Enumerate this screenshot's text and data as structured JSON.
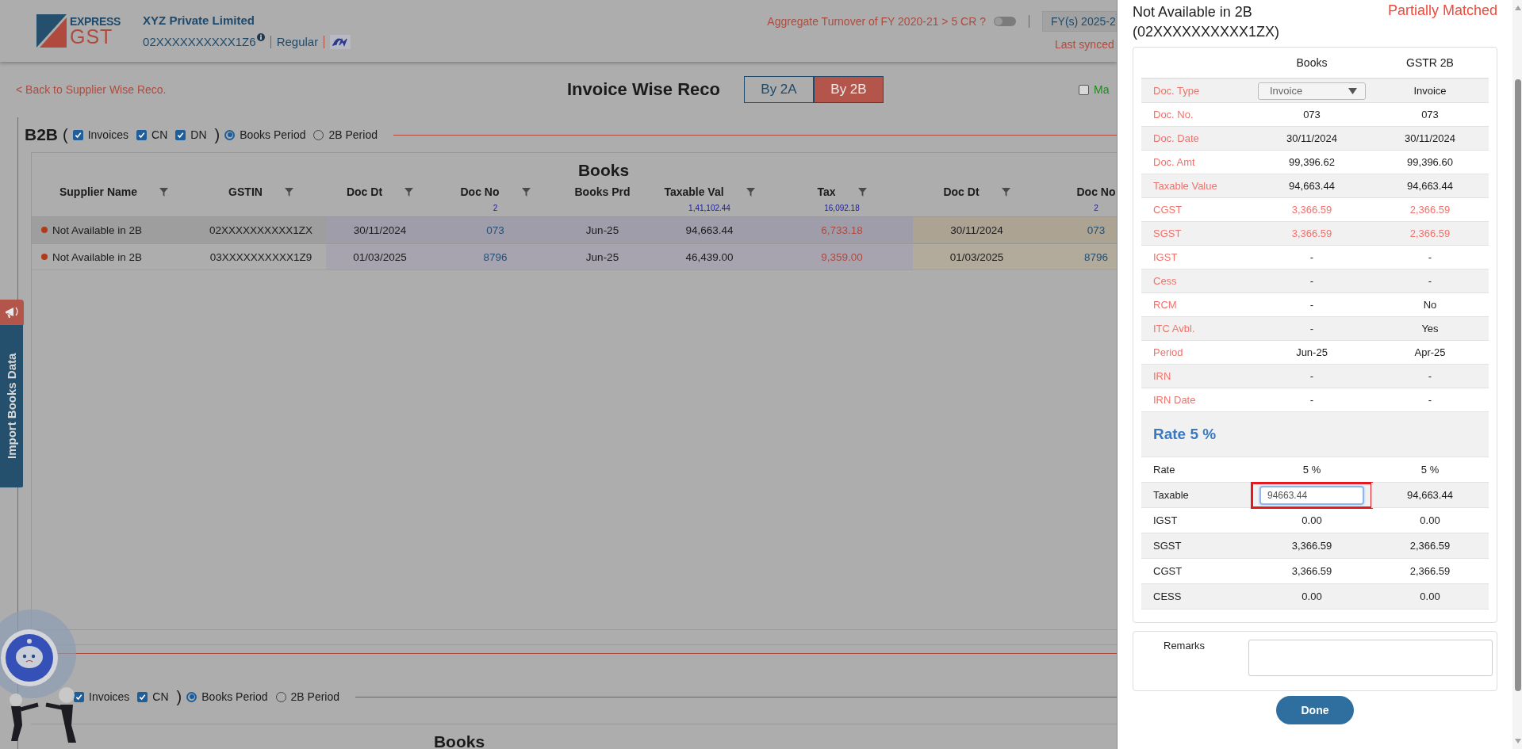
{
  "header": {
    "logo": {
      "line1": "EXPRESS",
      "line2": "GST"
    },
    "company": "XYZ Private Limited",
    "gstin": "02XXXXXXXXXX1Z6",
    "registration": "Regular",
    "turnover_label": "Aggregate Turnover of FY 2020-21 > 5 CR ?",
    "turnover_toggle": {
      "on": false
    },
    "fy": "FY(s) 2025-2",
    "last_synced": "Last synced"
  },
  "nav": {
    "back_link": "< Back to Supplier Wise Reco.",
    "title": "Invoice Wise Reco",
    "tabs": [
      {
        "label": "By 2A",
        "selected": false
      },
      {
        "label": "By 2B",
        "selected": true
      }
    ],
    "match_filter": {
      "label": "Ma",
      "checked": false
    }
  },
  "side_tab": {
    "label": "Import Books Data"
  },
  "sections": [
    {
      "title": "B2B",
      "open_paren": "(",
      "close_paren": ")",
      "filters": [
        {
          "label": "Invoices",
          "checked": true
        },
        {
          "label": "CN",
          "checked": true
        },
        {
          "label": "DN",
          "checked": true
        }
      ],
      "periods": [
        {
          "label": "Books Period",
          "selected": true
        },
        {
          "label": "2B Period",
          "selected": false
        }
      ],
      "table": {
        "group_heading": "Books",
        "columns": [
          {
            "label": "Supplier Name",
            "filter": true,
            "kind": "plain"
          },
          {
            "label": "GSTIN",
            "filter": true,
            "kind": "plain"
          },
          {
            "label": "Doc Dt",
            "filter": true,
            "kind": "books"
          },
          {
            "label": "Doc No",
            "filter": true,
            "total": "2",
            "kind": "bookslink"
          },
          {
            "label": "Books Prd",
            "filter": false,
            "kind": "books"
          },
          {
            "label": "Taxable Val",
            "filter": true,
            "total": "1,41,102.44",
            "kind": "books"
          },
          {
            "label": "Tax",
            "filter": true,
            "total": "16,092.18",
            "kind": "booksdiff"
          },
          {
            "label": "Doc Dt",
            "filter": true,
            "kind": "gstr"
          },
          {
            "label": "Doc No",
            "filter": false,
            "total": "2",
            "kind": "gstrlink"
          }
        ],
        "rows": [
          {
            "selected": true,
            "color": "#b23a18",
            "cells": [
              "Not Available in 2B",
              "02XXXXXXXXXX1ZX",
              "30/11/2024",
              "073",
              "Jun-25",
              "94,663.44",
              "6,733.18",
              "30/11/2024",
              "073"
            ]
          },
          {
            "selected": false,
            "color": "#b23a18",
            "cells": [
              "Not Available in 2B",
              "03XXXXXXXXXX1Z9",
              "01/03/2025",
              "8796",
              "Jun-25",
              "46,439.00",
              "9,359.00",
              "01/03/2025",
              "8796"
            ]
          }
        ]
      }
    },
    {
      "close_paren": ")",
      "filters": [
        {
          "label": "Invoices",
          "checked": true
        },
        {
          "label": "CN",
          "checked": true
        }
      ],
      "periods": [
        {
          "label": "Books Period",
          "selected": true
        },
        {
          "label": "2B Period",
          "selected": false
        }
      ],
      "table": {
        "group_heading": "Books"
      }
    }
  ],
  "drawer": {
    "title": "Not Available in 2B",
    "gstin": "(02XXXXXXXXXX1ZX)",
    "status": "Partially Matched",
    "columns": [
      "Books",
      "GSTR 2B"
    ],
    "fields": [
      {
        "label": "Doc. Type",
        "kind": "select",
        "books": "Invoice",
        "gstr": "Invoice",
        "mismatch": false
      },
      {
        "label": "Doc. No.",
        "kind": "text",
        "books": "073",
        "gstr": "073",
        "mismatch": false
      },
      {
        "label": "Doc. Date",
        "kind": "text",
        "books": "30/11/2024",
        "gstr": "30/11/2024",
        "mismatch": false
      },
      {
        "label": "Doc. Amt",
        "kind": "text",
        "books": "99,396.62",
        "gstr": "99,396.60",
        "mismatch": false
      },
      {
        "label": "Taxable Value",
        "kind": "text",
        "books": "94,663.44",
        "gstr": "94,663.44",
        "mismatch": false
      },
      {
        "label": "CGST",
        "kind": "text",
        "books": "3,366.59",
        "gstr": "2,366.59",
        "mismatch": true
      },
      {
        "label": "SGST",
        "kind": "text",
        "books": "3,366.59",
        "gstr": "2,366.59",
        "mismatch": true
      },
      {
        "label": "IGST",
        "kind": "text",
        "books": "-",
        "gstr": "-",
        "mismatch": false
      },
      {
        "label": "Cess",
        "kind": "text",
        "books": "-",
        "gstr": "-",
        "mismatch": false
      },
      {
        "label": "RCM",
        "kind": "text",
        "books": "-",
        "gstr": "No",
        "mismatch": false
      },
      {
        "label": "ITC Avbl.",
        "kind": "text",
        "books": "-",
        "gstr": "Yes",
        "mismatch": false
      },
      {
        "label": "Period",
        "kind": "text",
        "books": "Jun-25",
        "gstr": "Apr-25",
        "mismatch": false
      },
      {
        "label": "IRN",
        "kind": "text",
        "books": "-",
        "gstr": "-",
        "mismatch": false
      },
      {
        "label": "IRN Date",
        "kind": "text",
        "books": "-",
        "gstr": "-",
        "mismatch": false
      }
    ],
    "rate_heading": "Rate 5 %",
    "rate_rows": [
      {
        "label": "Rate",
        "kind": "text",
        "books": "5 %",
        "gstr": "5 %",
        "highlighted": false
      },
      {
        "label": "Taxable",
        "kind": "input",
        "books": "94663.44",
        "gstr": "94,663.44",
        "highlighted": true
      },
      {
        "label": "IGST",
        "kind": "text",
        "books": "0.00",
        "gstr": "0.00",
        "highlighted": false
      },
      {
        "label": "SGST",
        "kind": "text",
        "books": "3,366.59",
        "gstr": "2,366.59",
        "highlighted": false
      },
      {
        "label": "CGST",
        "kind": "text",
        "books": "3,366.59",
        "gstr": "2,366.59",
        "highlighted": false
      },
      {
        "label": "CESS",
        "kind": "text",
        "books": "0.00",
        "gstr": "0.00",
        "highlighted": false
      }
    ],
    "remarks_label": "Remarks",
    "done_button": "Done"
  }
}
